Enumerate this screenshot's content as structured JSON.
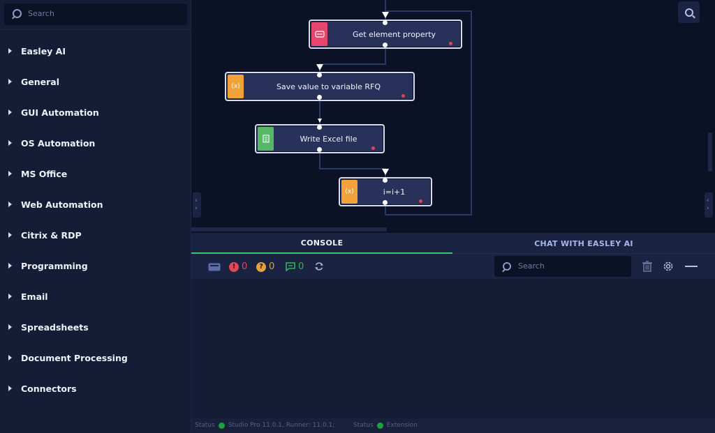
{
  "sidebar": {
    "search_placeholder": "Search",
    "items": [
      {
        "label": "Easley AI"
      },
      {
        "label": "General"
      },
      {
        "label": "GUI Automation"
      },
      {
        "label": "OS Automation"
      },
      {
        "label": "MS Office"
      },
      {
        "label": "Web Automation"
      },
      {
        "label": "Citrix & RDP"
      },
      {
        "label": "Programming"
      },
      {
        "label": "Email"
      },
      {
        "label": "Spreadsheets"
      },
      {
        "label": "Document Processing"
      },
      {
        "label": "Connectors"
      }
    ]
  },
  "flow": {
    "nodes": [
      {
        "label": "Get element property",
        "icon": "browser-icon",
        "badge_color": "#e5466d"
      },
      {
        "label": "Save value to variable RFQ",
        "icon": "variable-icon",
        "badge_text": "(x)",
        "badge_color": "#f2a23a"
      },
      {
        "label": "Write Excel file",
        "icon": "excel-file-icon",
        "badge_color": "#56b867"
      },
      {
        "label": "i=i+1",
        "icon": "variable-icon",
        "badge_text": "(x)",
        "badge_color": "#f2a23a"
      }
    ]
  },
  "panel": {
    "tabs": {
      "console": "CONSOLE",
      "chat": "CHAT WITH EASLEY AI"
    },
    "counts": {
      "errors": "0",
      "warnings": "0",
      "messages": "0"
    },
    "search_placeholder": "Search",
    "error_color": "#e04a55",
    "warning_color": "#e9a13b",
    "message_color": "#35b35c"
  },
  "status": {
    "label1": "Status",
    "text1": "Studio Pro 11.0.1, Runner: 11.0.1;",
    "label2": "Status",
    "text2": "Extension",
    "ok_color": "#1fa038"
  }
}
